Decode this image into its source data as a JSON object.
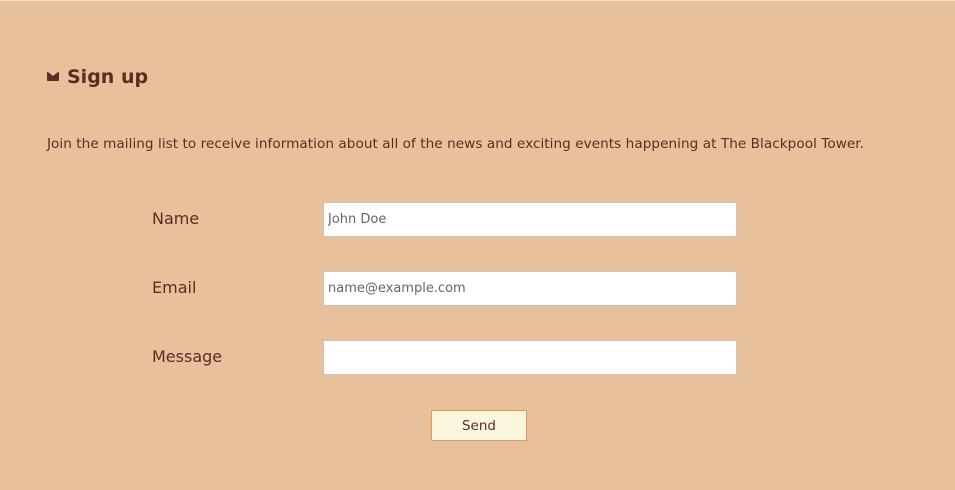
{
  "signup": {
    "icon": "envelope-icon",
    "title": "Sign up",
    "intro": "Join the mailing list to receive information about all of the news and exciting events happening at The Blackpool Tower."
  },
  "form": {
    "name_label": "Name",
    "name_placeholder": "John Doe",
    "name_value": "",
    "email_label": "Email",
    "email_placeholder": "name@example.com",
    "email_value": "",
    "message_label": "Message",
    "message_value": "",
    "send_label": "Send"
  },
  "colors": {
    "background": "#e9c09c",
    "text": "#5c2b23",
    "button_background": "#fdf6df",
    "button_border": "#e89a55"
  }
}
